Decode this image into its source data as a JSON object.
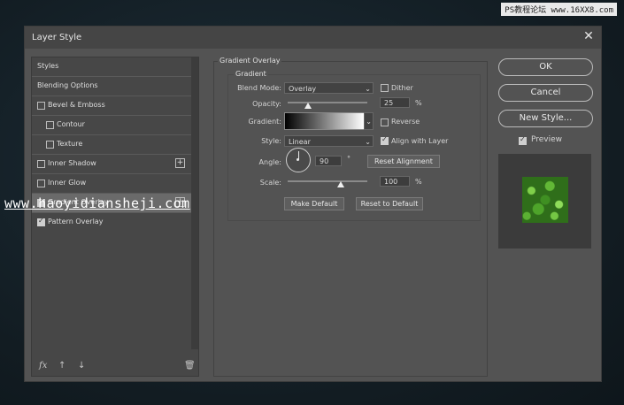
{
  "watermark_top": "PS教程论坛 www.16XX8.com",
  "watermark_mid": "www.haoyidiansheji.com",
  "dialog": {
    "title": "Layer Style",
    "close_icon": "close-icon"
  },
  "left_list": {
    "items": [
      {
        "label": "Styles",
        "checkbox": false,
        "checked": false,
        "plus": false
      },
      {
        "label": "Blending Options",
        "checkbox": false,
        "checked": false,
        "plus": false
      },
      {
        "label": "Bevel & Emboss",
        "checkbox": true,
        "checked": false,
        "plus": false
      },
      {
        "label": "Contour",
        "checkbox": true,
        "checked": false,
        "plus": false
      },
      {
        "label": "Texture",
        "checkbox": true,
        "checked": false,
        "plus": false
      },
      {
        "label": "Inner Shadow",
        "checkbox": true,
        "checked": false,
        "plus": true
      },
      {
        "label": "Inner Glow",
        "checkbox": true,
        "checked": false,
        "plus": false
      },
      {
        "label": "Gradient Overlay",
        "checkbox": true,
        "checked": true,
        "plus": true
      },
      {
        "label": "Pattern Overlay",
        "checkbox": true,
        "checked": true,
        "plus": false
      }
    ],
    "footer": {
      "fx": "fx",
      "up": "↑",
      "down": "↓",
      "trash": "🗑"
    }
  },
  "gradient_overlay": {
    "section_title": "Gradient Overlay",
    "sub_title": "Gradient",
    "blend_mode_label": "Blend Mode:",
    "blend_mode": "Overlay",
    "dither_label": "Dither",
    "dither_checked": false,
    "opacity_label": "Opacity:",
    "opacity_value": "25",
    "opacity_unit": "%",
    "opacity_fraction": 0.25,
    "gradient_label": "Gradient:",
    "reverse_label": "Reverse",
    "reverse_checked": false,
    "style_label": "Style:",
    "style_value": "Linear",
    "align_label": "Align with Layer",
    "align_checked": true,
    "angle_label": "Angle:",
    "angle_value": "90",
    "angle_unit": "°",
    "reset_alignment": "Reset Alignment",
    "scale_label": "Scale:",
    "scale_value": "100",
    "scale_unit": "%",
    "scale_fraction": 0.67,
    "make_default": "Make Default",
    "reset_default": "Reset to Default"
  },
  "right_panel": {
    "ok": "OK",
    "cancel": "Cancel",
    "new_style": "New Style...",
    "preview_label": "Preview",
    "preview_checked": true
  }
}
